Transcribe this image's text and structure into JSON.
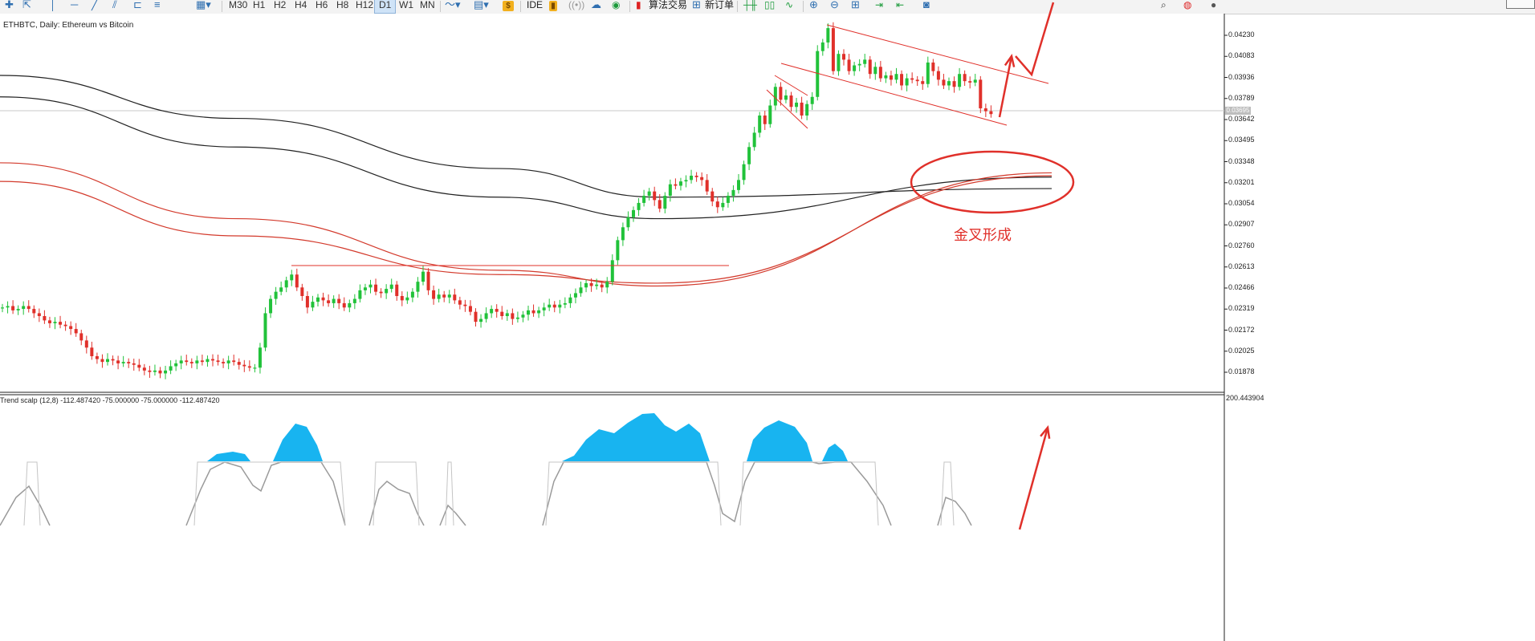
{
  "toolbar": {
    "periods": [
      "M30",
      "H1",
      "H2",
      "H4",
      "H6",
      "H8",
      "H12",
      "D1",
      "W1",
      "MN"
    ],
    "active_period": "D1",
    "ide_label": "IDE",
    "algo_trading_label": "算法交易",
    "new_order_label": "新订单"
  },
  "chart": {
    "title": "ETHBTC, Daily: Ethereum vs Bitcoin",
    "price_labels": [
      "0.04230",
      "0.04083",
      "0.03936",
      "0.03789",
      "0.03642",
      "0.03495",
      "0.03348",
      "0.03201",
      "0.03054",
      "0.02907",
      "0.02760",
      "0.02613",
      "0.02466",
      "0.02319",
      "0.02172",
      "0.02025",
      "0.01878"
    ],
    "last_price": "0.03695",
    "annotation": "金叉形成",
    "colors": {
      "bull_candle": "#21c23a",
      "bear_candle": "#e0302a",
      "black_ma": "#222222",
      "red_ma": "#d33a2c",
      "annotation": "#e0302a",
      "oscillator_fill": "#18b4f0"
    }
  },
  "indicator": {
    "title": "Trend scalp (12,8) -112.487420 -75.000000 -75.000000 -112.487420",
    "scale_top": "200.443904"
  },
  "chart_data": {
    "type": "candlestick",
    "symbol": "ETHBTC",
    "timeframe": "Daily",
    "ylim": [
      0.0173,
      0.0438
    ],
    "close": [
      0.0233,
      0.0234,
      0.0231,
      0.0232,
      0.0234,
      0.0232,
      0.0229,
      0.0227,
      0.0224,
      0.0222,
      0.0223,
      0.0221,
      0.022,
      0.0218,
      0.0215,
      0.021,
      0.0205,
      0.0199,
      0.0197,
      0.0195,
      0.0197,
      0.0196,
      0.0194,
      0.0195,
      0.0194,
      0.0193,
      0.0191,
      0.0189,
      0.0188,
      0.0189,
      0.0187,
      0.0189,
      0.0192,
      0.0194,
      0.0196,
      0.0195,
      0.0194,
      0.0196,
      0.0195,
      0.0197,
      0.0196,
      0.0195,
      0.0194,
      0.0196,
      0.0195,
      0.0193,
      0.0192,
      0.0191,
      0.0191,
      0.0205,
      0.0229,
      0.0239,
      0.0244,
      0.0247,
      0.0252,
      0.0256,
      0.0247,
      0.0241,
      0.0233,
      0.0237,
      0.024,
      0.0238,
      0.0236,
      0.0239,
      0.0236,
      0.0233,
      0.0236,
      0.0239,
      0.0245,
      0.0247,
      0.0249,
      0.0244,
      0.0243,
      0.0246,
      0.0249,
      0.0241,
      0.0238,
      0.024,
      0.0244,
      0.0251,
      0.0258,
      0.0245,
      0.0239,
      0.0242,
      0.024,
      0.0242,
      0.0238,
      0.0235,
      0.0234,
      0.023,
      0.0223,
      0.0225,
      0.0229,
      0.0232,
      0.023,
      0.0227,
      0.0229,
      0.0225,
      0.0226,
      0.0228,
      0.0231,
      0.0229,
      0.0231,
      0.0233,
      0.0235,
      0.0233,
      0.0235,
      0.0236,
      0.024,
      0.0243,
      0.0247,
      0.025,
      0.0248,
      0.0249,
      0.0247,
      0.0251,
      0.0266,
      0.028,
      0.0289,
      0.0296,
      0.0301,
      0.0306,
      0.0311,
      0.0314,
      0.0308,
      0.0302,
      0.0311,
      0.0319,
      0.0318,
      0.0321,
      0.0322,
      0.0325,
      0.0324,
      0.0322,
      0.0314,
      0.0307,
      0.0303,
      0.0306,
      0.0311,
      0.0315,
      0.0322,
      0.0333,
      0.0345,
      0.0355,
      0.0367,
      0.0361,
      0.0374,
      0.0387,
      0.0378,
      0.0381,
      0.0373,
      0.0376,
      0.0367,
      0.0375,
      0.038,
      0.0412,
      0.0418,
      0.0428,
      0.0398,
      0.041,
      0.0406,
      0.0398,
      0.0402,
      0.0403,
      0.0406,
      0.0396,
      0.0401,
      0.0393,
      0.0395,
      0.0392,
      0.0396,
      0.0388,
      0.0393,
      0.0392,
      0.0391,
      0.0389,
      0.0404,
      0.0398,
      0.0392,
      0.0388,
      0.0391,
      0.0387,
      0.0396,
      0.0391,
      0.039,
      0.0392,
      0.0372,
      0.037,
      0.0368
    ],
    "moving_averages": [
      {
        "color": "black",
        "values": [
          0.0395,
          0.0365,
          0.033,
          0.031,
          0.0316
        ]
      },
      {
        "color": "black",
        "values": [
          0.038,
          0.0345,
          0.031,
          0.0295,
          0.0324
        ]
      },
      {
        "color": "red",
        "values": [
          0.0334,
          0.0295,
          0.0259,
          0.0248,
          0.0327
        ]
      },
      {
        "color": "red",
        "values": [
          0.0321,
          0.0283,
          0.0256,
          0.025,
          0.0325
        ]
      }
    ],
    "ma_x_days": [
      0,
      45,
      95,
      125,
      200
    ],
    "oscillator": {
      "scale_top": 200.443904
    }
  }
}
